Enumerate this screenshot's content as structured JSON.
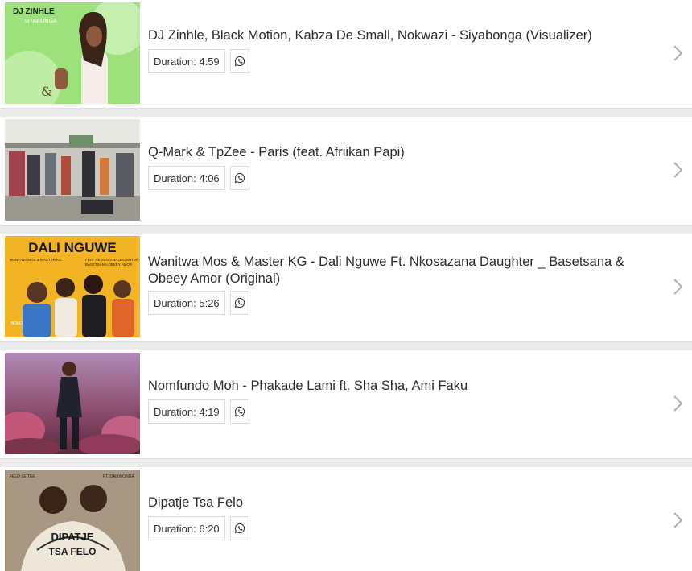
{
  "icons": {
    "share": "whatsapp-icon",
    "open": "chevron-right-icon"
  },
  "colors": {
    "background": "#ebebeb",
    "card": "#ffffff",
    "text": "#2b2b2b",
    "border": "#dcdcdc",
    "chevron": "#b0b0b0"
  },
  "items": [
    {
      "title": "DJ Zinhle, Black Motion, Kabza De Small, Nokwazi - Siyabonga (Visualizer)",
      "duration": "Duration: 4:59",
      "thumb_text": [
        "DJ ZINHLE",
        "SIYABONGA"
      ]
    },
    {
      "title": "Q-Mark & TpZee - Paris (feat. Afriikan Papi)",
      "duration": "Duration: 4:06"
    },
    {
      "title": "Wanitwa Mos & Master KG - Dali Nguwe Ft. Nkosazana Daughter _ Basetsana & Obeey Amor (Original)",
      "duration": "Duration: 5:26",
      "thumb_text": [
        "DALI NGUWE",
        "WANITWA MOS & MASTER KG",
        "FEAT NKOSAZANA DAUGHTER",
        "BASETSANA,OBEEY AMOR"
      ]
    },
    {
      "title": "Nomfundo Moh - Phakade Lami ft. Sha Sha, Ami Faku",
      "duration": "Duration: 4:19"
    },
    {
      "title": "Dipatje Tsa Felo",
      "duration": "Duration: 6:20",
      "thumb_text": [
        "FELO LE TEE",
        "FT. DALIWONGA",
        "DIPATJE",
        "TSA FELO"
      ]
    }
  ]
}
